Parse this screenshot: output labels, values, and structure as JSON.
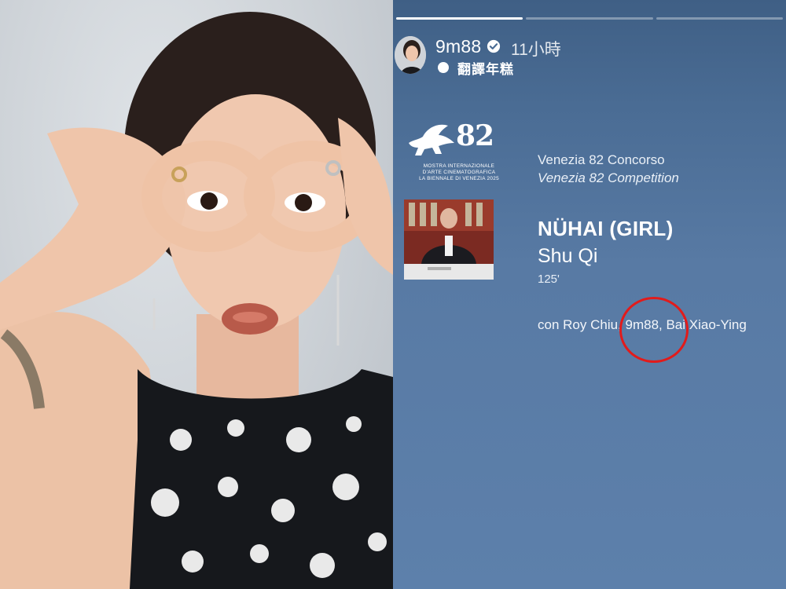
{
  "story": {
    "progress": {
      "total_segments": 3,
      "completed_segments": 1
    },
    "header": {
      "username": "9m88",
      "verified": true,
      "time_ago": "11小時",
      "translate_label": "翻譯年糕"
    },
    "logo": {
      "number": "82",
      "line1": "MOSTRA INTERNAZIONALE",
      "line2": "D'ARTE CINEMATOGRAFICA",
      "line3": "LA BIENNALE DI VENEZIA 2025"
    },
    "festival": {
      "italian": "Venezia 82 Concorso",
      "english": "Venezia 82 Competition"
    },
    "film": {
      "title": "NÜHAI (GIRL)",
      "director": "Shu Qi",
      "runtime": "125'",
      "cast": "con Roy Chiu, 9m88, Bai Xiao-Ying"
    }
  },
  "colors": {
    "story_bg": "#5d80ab",
    "highlight": "#e21b1b",
    "text": "#ffffff"
  }
}
